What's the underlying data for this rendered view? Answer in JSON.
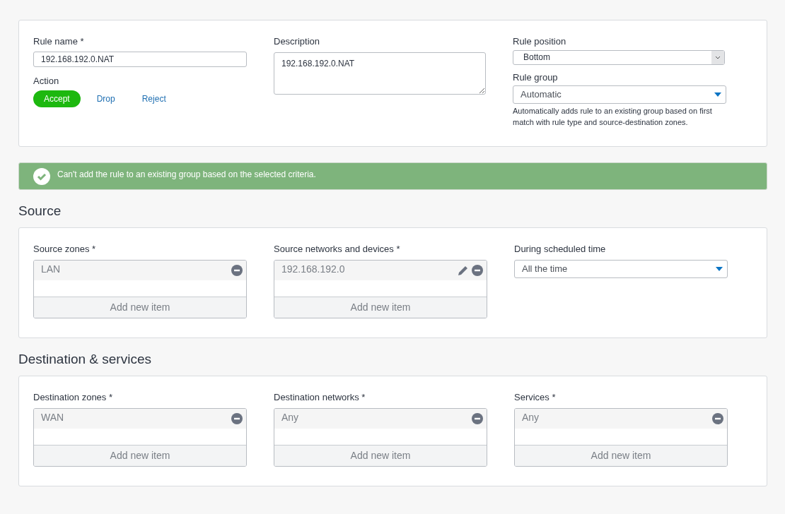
{
  "general": {
    "rule_name": {
      "label": "Rule name *",
      "value": "192.168.192.0.NAT"
    },
    "action": {
      "label": "Action",
      "options": [
        {
          "label": "Accept",
          "selected": true
        },
        {
          "label": "Drop",
          "selected": false
        },
        {
          "label": "Reject",
          "selected": false
        }
      ]
    },
    "description": {
      "label": "Description",
      "value": "192.168.192.0.NAT"
    },
    "rule_position": {
      "label": "Rule position",
      "value": "Bottom"
    },
    "rule_group": {
      "label": "Rule group",
      "value": "Automatic",
      "help": "Automatically adds rule to an existing group based on first match with rule type and source-destination zones."
    }
  },
  "notice": {
    "text": "Can't add the rule to an existing group based on the selected criteria."
  },
  "sections": [
    {
      "title": "Source",
      "fields": [
        {
          "kind": "list",
          "label": "Source zones *",
          "items": [
            {
              "text": "LAN",
              "editable": false
            }
          ],
          "add_label": "Add new item"
        },
        {
          "kind": "list",
          "label": "Source networks and devices *",
          "items": [
            {
              "text": "192.168.192.0",
              "editable": true
            }
          ],
          "add_label": "Add new item"
        },
        {
          "kind": "select",
          "label": "During scheduled time",
          "value": "All the time"
        }
      ]
    },
    {
      "title": "Destination & services",
      "fields": [
        {
          "kind": "list",
          "label": "Destination zones *",
          "items": [
            {
              "text": "WAN",
              "editable": false
            }
          ],
          "add_label": "Add new item"
        },
        {
          "kind": "list",
          "label": "Destination networks *",
          "items": [
            {
              "text": "Any",
              "editable": false
            }
          ],
          "add_label": "Add new item"
        },
        {
          "kind": "list",
          "label": "Services *",
          "items": [
            {
              "text": "Any",
              "editable": false
            }
          ],
          "add_label": "Add new item"
        }
      ]
    }
  ]
}
